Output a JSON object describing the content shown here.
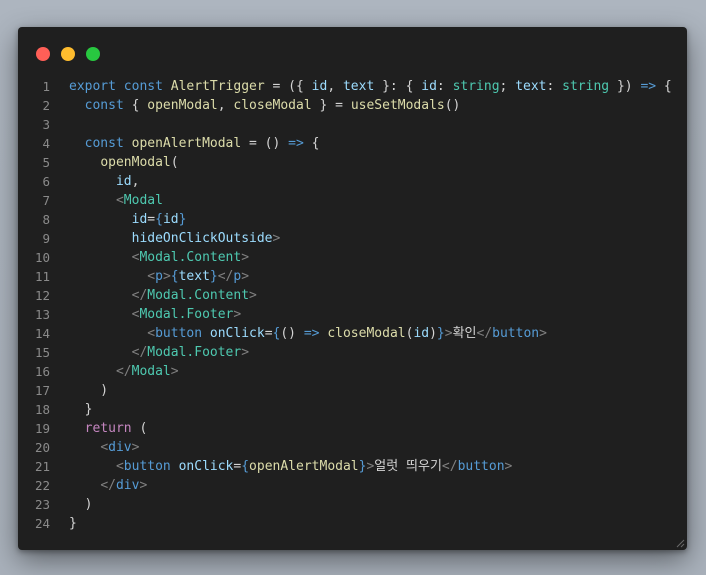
{
  "window": {
    "controls": [
      {
        "name": "close",
        "color": "#ff5f57"
      },
      {
        "name": "minimize",
        "color": "#febc2e"
      },
      {
        "name": "maximize",
        "color": "#28c840"
      }
    ]
  },
  "code": {
    "lines": [
      [
        [
          "kw",
          "export"
        ],
        [
          "plain",
          " "
        ],
        [
          "kw",
          "const"
        ],
        [
          "plain",
          " "
        ],
        [
          "fn",
          "AlertTrigger"
        ],
        [
          "plain",
          " = ({ "
        ],
        [
          "var",
          "id"
        ],
        [
          "plain",
          ", "
        ],
        [
          "var",
          "text"
        ],
        [
          "plain",
          " }: { "
        ],
        [
          "var",
          "id"
        ],
        [
          "plain",
          ": "
        ],
        [
          "type",
          "string"
        ],
        [
          "plain",
          "; "
        ],
        [
          "var",
          "text"
        ],
        [
          "plain",
          ": "
        ],
        [
          "type",
          "string"
        ],
        [
          "plain",
          " }) "
        ],
        [
          "kw",
          "=>"
        ],
        [
          "plain",
          " {"
        ]
      ],
      [
        [
          "plain",
          "  "
        ],
        [
          "kw",
          "const"
        ],
        [
          "plain",
          " { "
        ],
        [
          "fn",
          "openModal"
        ],
        [
          "plain",
          ", "
        ],
        [
          "fn",
          "closeModal"
        ],
        [
          "plain",
          " } = "
        ],
        [
          "fn",
          "useSetModals"
        ],
        [
          "plain",
          "()"
        ]
      ],
      [
        [
          "plain",
          ""
        ]
      ],
      [
        [
          "plain",
          "  "
        ],
        [
          "kw",
          "const"
        ],
        [
          "plain",
          " "
        ],
        [
          "fn",
          "openAlertModal"
        ],
        [
          "plain",
          " = () "
        ],
        [
          "kw",
          "=>"
        ],
        [
          "plain",
          " {"
        ]
      ],
      [
        [
          "plain",
          "    "
        ],
        [
          "fn",
          "openModal"
        ],
        [
          "plain",
          "("
        ]
      ],
      [
        [
          "plain",
          "      "
        ],
        [
          "var",
          "id"
        ],
        [
          "plain",
          ","
        ]
      ],
      [
        [
          "plain",
          "      "
        ],
        [
          "tag",
          "<"
        ],
        [
          "comp",
          "Modal"
        ]
      ],
      [
        [
          "plain",
          "        "
        ],
        [
          "attr",
          "id"
        ],
        [
          "plain",
          "="
        ],
        [
          "brace",
          "{"
        ],
        [
          "var",
          "id"
        ],
        [
          "brace",
          "}"
        ]
      ],
      [
        [
          "plain",
          "        "
        ],
        [
          "attr",
          "hideOnClickOutside"
        ],
        [
          "tag",
          ">"
        ]
      ],
      [
        [
          "plain",
          "        "
        ],
        [
          "tag",
          "<"
        ],
        [
          "comp",
          "Modal.Content"
        ],
        [
          "tag",
          ">"
        ]
      ],
      [
        [
          "plain",
          "          "
        ],
        [
          "tag",
          "<"
        ],
        [
          "html",
          "p"
        ],
        [
          "tag",
          ">"
        ],
        [
          "brace",
          "{"
        ],
        [
          "var",
          "text"
        ],
        [
          "brace",
          "}"
        ],
        [
          "tag",
          "</"
        ],
        [
          "html",
          "p"
        ],
        [
          "tag",
          ">"
        ]
      ],
      [
        [
          "plain",
          "        "
        ],
        [
          "tag",
          "</"
        ],
        [
          "comp",
          "Modal.Content"
        ],
        [
          "tag",
          ">"
        ]
      ],
      [
        [
          "plain",
          "        "
        ],
        [
          "tag",
          "<"
        ],
        [
          "comp",
          "Modal.Footer"
        ],
        [
          "tag",
          ">"
        ]
      ],
      [
        [
          "plain",
          "          "
        ],
        [
          "tag",
          "<"
        ],
        [
          "html",
          "button"
        ],
        [
          "plain",
          " "
        ],
        [
          "attr",
          "onClick"
        ],
        [
          "plain",
          "="
        ],
        [
          "brace",
          "{"
        ],
        [
          "plain",
          "() "
        ],
        [
          "kw",
          "=>"
        ],
        [
          "plain",
          " "
        ],
        [
          "fn",
          "closeModal"
        ],
        [
          "plain",
          "("
        ],
        [
          "var",
          "id"
        ],
        [
          "plain",
          ")"
        ],
        [
          "brace",
          "}"
        ],
        [
          "tag",
          ">"
        ],
        [
          "plain",
          "확인"
        ],
        [
          "tag",
          "</"
        ],
        [
          "html",
          "button"
        ],
        [
          "tag",
          ">"
        ]
      ],
      [
        [
          "plain",
          "        "
        ],
        [
          "tag",
          "</"
        ],
        [
          "comp",
          "Modal.Footer"
        ],
        [
          "tag",
          ">"
        ]
      ],
      [
        [
          "plain",
          "      "
        ],
        [
          "tag",
          "</"
        ],
        [
          "comp",
          "Modal"
        ],
        [
          "tag",
          ">"
        ]
      ],
      [
        [
          "plain",
          "    )"
        ]
      ],
      [
        [
          "plain",
          "  }"
        ]
      ],
      [
        [
          "plain",
          "  "
        ],
        [
          "kw2",
          "return"
        ],
        [
          "plain",
          " ("
        ]
      ],
      [
        [
          "plain",
          "    "
        ],
        [
          "tag",
          "<"
        ],
        [
          "html",
          "div"
        ],
        [
          "tag",
          ">"
        ]
      ],
      [
        [
          "plain",
          "      "
        ],
        [
          "tag",
          "<"
        ],
        [
          "html",
          "button"
        ],
        [
          "plain",
          " "
        ],
        [
          "attr",
          "onClick"
        ],
        [
          "plain",
          "="
        ],
        [
          "brace",
          "{"
        ],
        [
          "fn",
          "openAlertModal"
        ],
        [
          "brace",
          "}"
        ],
        [
          "tag",
          ">"
        ],
        [
          "plain",
          "얼럿 띄우기"
        ],
        [
          "tag",
          "</"
        ],
        [
          "html",
          "button"
        ],
        [
          "tag",
          ">"
        ]
      ],
      [
        [
          "plain",
          "    "
        ],
        [
          "tag",
          "</"
        ],
        [
          "html",
          "div"
        ],
        [
          "tag",
          ">"
        ]
      ],
      [
        [
          "plain",
          "  )"
        ]
      ],
      [
        [
          "plain",
          "}"
        ]
      ]
    ]
  }
}
